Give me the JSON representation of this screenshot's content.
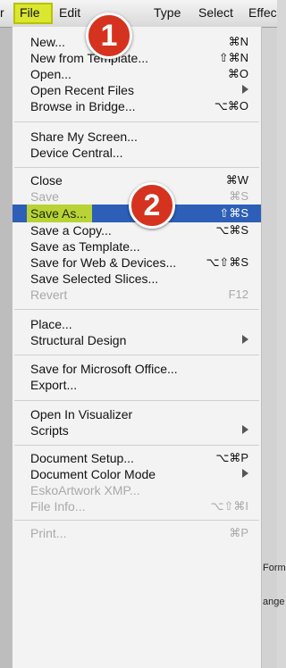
{
  "menubar": {
    "items": [
      "r",
      "File",
      "Edit",
      "Type",
      "Select",
      "Effec"
    ]
  },
  "file_menu": {
    "items": [
      {
        "label": "New...",
        "shortcut": "⌘N",
        "enabled": true
      },
      {
        "label": "New from Template...",
        "shortcut": "⇧⌘N",
        "enabled": true
      },
      {
        "label": "Open...",
        "shortcut": "⌘O",
        "enabled": true
      },
      {
        "label": "Open Recent Files",
        "shortcut": "",
        "submenu": true,
        "enabled": true
      },
      {
        "label": "Browse in Bridge...",
        "shortcut": "⌥⌘O",
        "enabled": true
      },
      {
        "label": "Share My Screen...",
        "shortcut": "",
        "enabled": true
      },
      {
        "label": "Device Central...",
        "shortcut": "",
        "enabled": true
      },
      {
        "label": "Close",
        "shortcut": "⌘W",
        "enabled": true
      },
      {
        "label": "Save",
        "shortcut": "⌘S",
        "enabled": false
      },
      {
        "label": "Save As...",
        "shortcut": "⇧⌘S",
        "enabled": true,
        "selected": true
      },
      {
        "label": "Save a Copy...",
        "shortcut": "⌥⌘S",
        "enabled": true
      },
      {
        "label": "Save as Template...",
        "shortcut": "",
        "enabled": true
      },
      {
        "label": "Save for Web & Devices...",
        "shortcut": "⌥⇧⌘S",
        "enabled": true
      },
      {
        "label": "Save Selected Slices...",
        "shortcut": "",
        "enabled": true
      },
      {
        "label": "Revert",
        "shortcut": "F12",
        "enabled": false
      },
      {
        "label": "Place...",
        "shortcut": "",
        "enabled": true
      },
      {
        "label": "Structural Design",
        "shortcut": "",
        "submenu": true,
        "enabled": true
      },
      {
        "label": "Save for Microsoft Office...",
        "shortcut": "",
        "enabled": true
      },
      {
        "label": "Export...",
        "shortcut": "",
        "enabled": true
      },
      {
        "label": "Open In Visualizer",
        "shortcut": "",
        "enabled": true
      },
      {
        "label": "Scripts",
        "shortcut": "",
        "submenu": true,
        "enabled": true
      },
      {
        "label": "Document Setup...",
        "shortcut": "⌥⌘P",
        "enabled": true
      },
      {
        "label": "Document Color Mode",
        "shortcut": "",
        "submenu": true,
        "enabled": true
      },
      {
        "label": "EskoArtwork XMP...",
        "shortcut": "",
        "enabled": false
      },
      {
        "label": "File Info...",
        "shortcut": "⌥⇧⌘I",
        "enabled": false
      },
      {
        "label": "Print...",
        "shortcut": "⌘P",
        "enabled": false
      }
    ]
  },
  "badges": [
    "1",
    "2"
  ],
  "background_panel": {
    "label_1": "Form",
    "label_2": "ange"
  },
  "colors": {
    "highlight": "#dbe631",
    "selection": "#2d5fb8",
    "badge": "#d5331f"
  }
}
